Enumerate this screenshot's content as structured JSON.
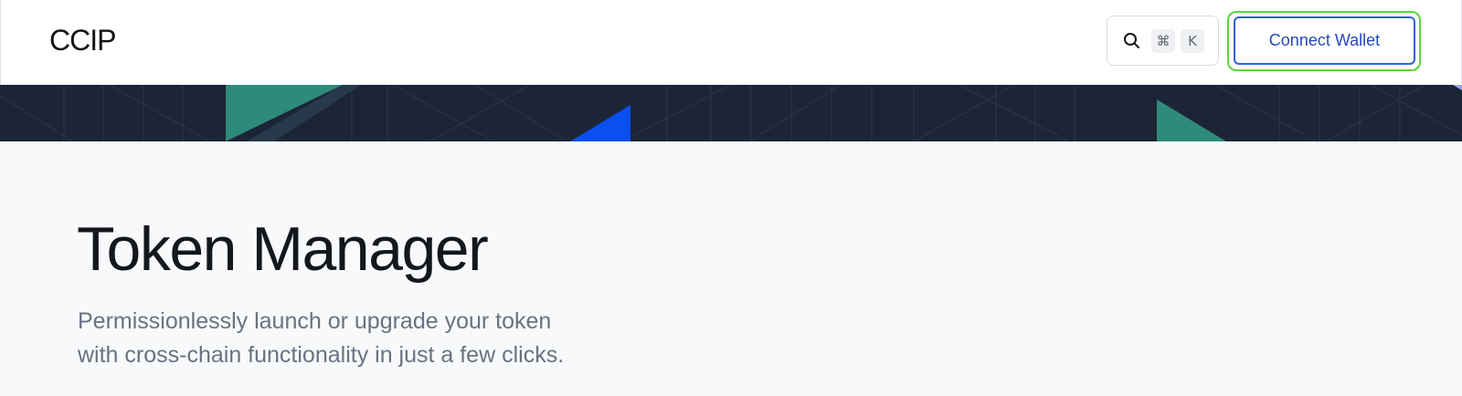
{
  "header": {
    "logo": "CCIP",
    "search": {
      "icon": "search-icon",
      "shortcut_keys": [
        "⌘",
        "K"
      ]
    },
    "connect_wallet_label": "Connect Wallet"
  },
  "hero": {
    "title": "Token Manager",
    "description_line1": "Permissionlessly launch or upgrade your token",
    "description_line2": "with cross-chain functionality in just a few clicks."
  },
  "colors": {
    "banner_bg": "#1c2536",
    "accent_teal": "#2e8a79",
    "accent_blue": "#0a4ff0",
    "connect_border": "#2e63d8",
    "focus_ring": "#5bd43f"
  }
}
